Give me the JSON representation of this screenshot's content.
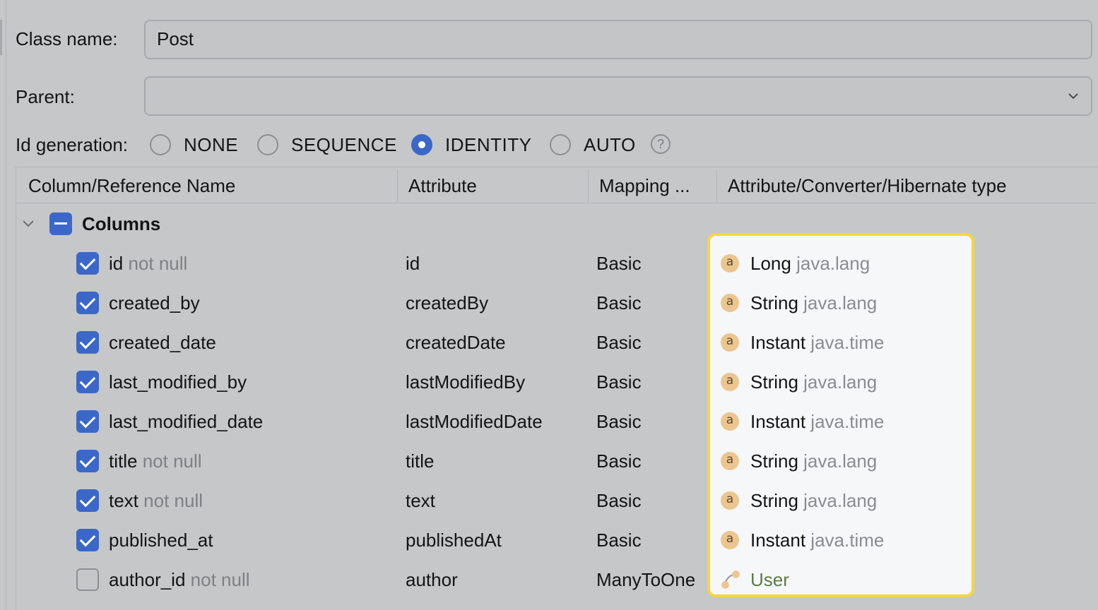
{
  "form": {
    "class_name_label": "Class name:",
    "class_name_value": "Post",
    "parent_label": "Parent:",
    "parent_value": "",
    "id_generation_label": "Id generation:",
    "id_generation_options": [
      "NONE",
      "SEQUENCE",
      "IDENTITY",
      "AUTO"
    ],
    "id_generation_selected": "IDENTITY",
    "help_glyph": "?"
  },
  "table": {
    "headers": [
      "Column/Reference Name",
      "Attribute",
      "Mapping ...",
      "Attribute/Converter/Hibernate type"
    ],
    "group_label": "Columns",
    "rows": [
      {
        "name": "id",
        "suffix": "not null",
        "attribute": "id",
        "mapping": "Basic",
        "type": "Long",
        "package": "java.lang",
        "checked": true
      },
      {
        "name": "created_by",
        "suffix": "",
        "attribute": "createdBy",
        "mapping": "Basic",
        "type": "String",
        "package": "java.lang",
        "checked": true
      },
      {
        "name": "created_date",
        "suffix": "",
        "attribute": "createdDate",
        "mapping": "Basic",
        "type": "Instant",
        "package": "java.time",
        "checked": true
      },
      {
        "name": "last_modified_by",
        "suffix": "",
        "attribute": "lastModifiedBy",
        "mapping": "Basic",
        "type": "String",
        "package": "java.lang",
        "checked": true
      },
      {
        "name": "last_modified_date",
        "suffix": "",
        "attribute": "lastModifiedDate",
        "mapping": "Basic",
        "type": "Instant",
        "package": "java.time",
        "checked": true
      },
      {
        "name": "title",
        "suffix": "not null",
        "attribute": "title",
        "mapping": "Basic",
        "type": "String",
        "package": "java.lang",
        "checked": true
      },
      {
        "name": "text",
        "suffix": "not null",
        "attribute": "text",
        "mapping": "Basic",
        "type": "String",
        "package": "java.lang",
        "checked": true
      },
      {
        "name": "published_at",
        "suffix": "",
        "attribute": "publishedAt",
        "mapping": "Basic",
        "type": "Instant",
        "package": "java.time",
        "checked": true
      },
      {
        "name": "author_id",
        "suffix": "not null",
        "attribute": "author",
        "mapping": "ManyToOne",
        "type": "User",
        "package": "",
        "checked": false
      }
    ]
  },
  "icons": {
    "chevron": "chevron-down-icon",
    "attribute": "attribute-icon",
    "relation": "relation-icon",
    "collapse": "chevron-down-icon"
  },
  "colors": {
    "accent": "#3b68c8",
    "highlight_border": "#f5d73d",
    "entity_text": "#5f7a45"
  },
  "type_icon_letter": "a"
}
